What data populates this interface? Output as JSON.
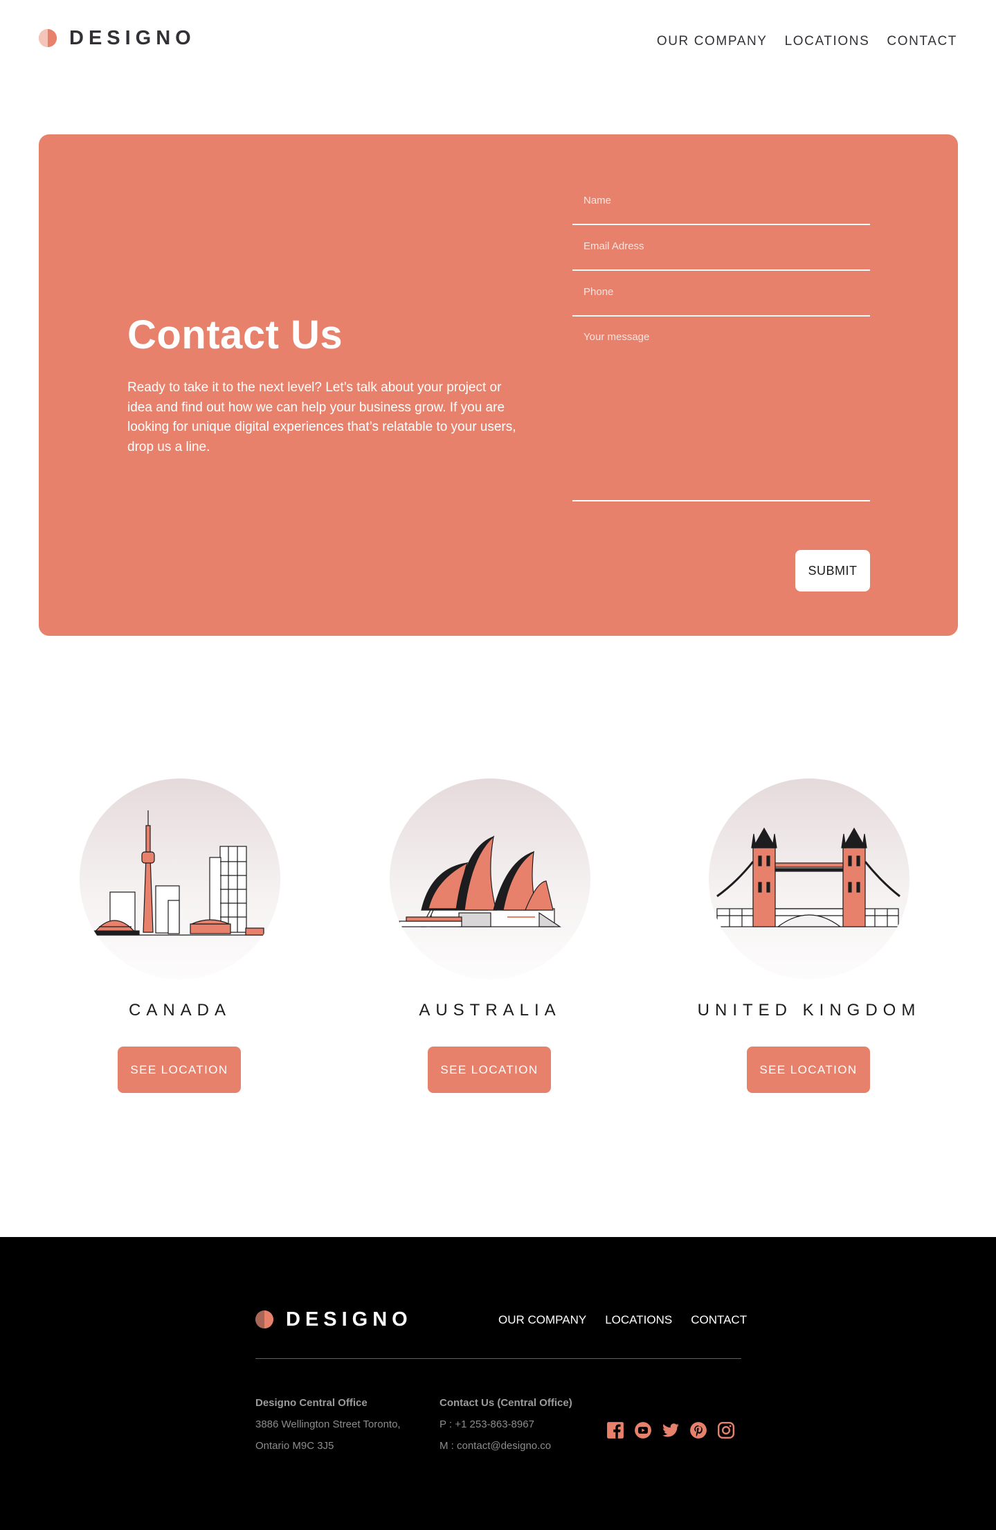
{
  "header": {
    "logo_text": "DESIGNO",
    "nav": [
      "OUR COMPANY",
      "LOCATIONS",
      "CONTACT"
    ]
  },
  "contact": {
    "title": "Contact Us",
    "text": "Ready to take it to the next level? Let’s talk about your project or idea and find out how we can help your business grow. If you are looking for unique digital experiences that’s relatable to your users, drop us a line.",
    "form": {
      "name_placeholder": "Name",
      "email_placeholder": "Email Adress",
      "phone_placeholder": "Phone",
      "message_placeholder": "Your message",
      "submit_label": "SUBMIT"
    }
  },
  "locations": [
    {
      "name": "CANADA",
      "button": "SEE LOCATION",
      "icon": "toronto-skyline-icon"
    },
    {
      "name": "AUSTRALIA",
      "button": "SEE LOCATION",
      "icon": "sydney-opera-house-icon"
    },
    {
      "name": "UNITED KINGDOM",
      "button": "SEE LOCATION",
      "icon": "tower-bridge-icon"
    }
  ],
  "footer": {
    "logo_text": "DESIGNO",
    "nav": [
      "OUR COMPANY",
      "LOCATIONS",
      "CONTACT"
    ],
    "office": {
      "heading": "Designo Central Office",
      "line1": "3886 Wellington Street Toronto,",
      "line2": "Ontario M9C 3J5"
    },
    "contact": {
      "heading": "Contact Us (Central Office)",
      "phone": "P : +1 253-863-8967",
      "email": "M : contact@designo.co"
    },
    "social": [
      "facebook-icon",
      "youtube-icon",
      "twitter-icon",
      "pinterest-icon",
      "instagram-icon"
    ]
  },
  "colors": {
    "accent": "#e7816b",
    "dark": "#333136",
    "footer_bg": "#000000"
  }
}
